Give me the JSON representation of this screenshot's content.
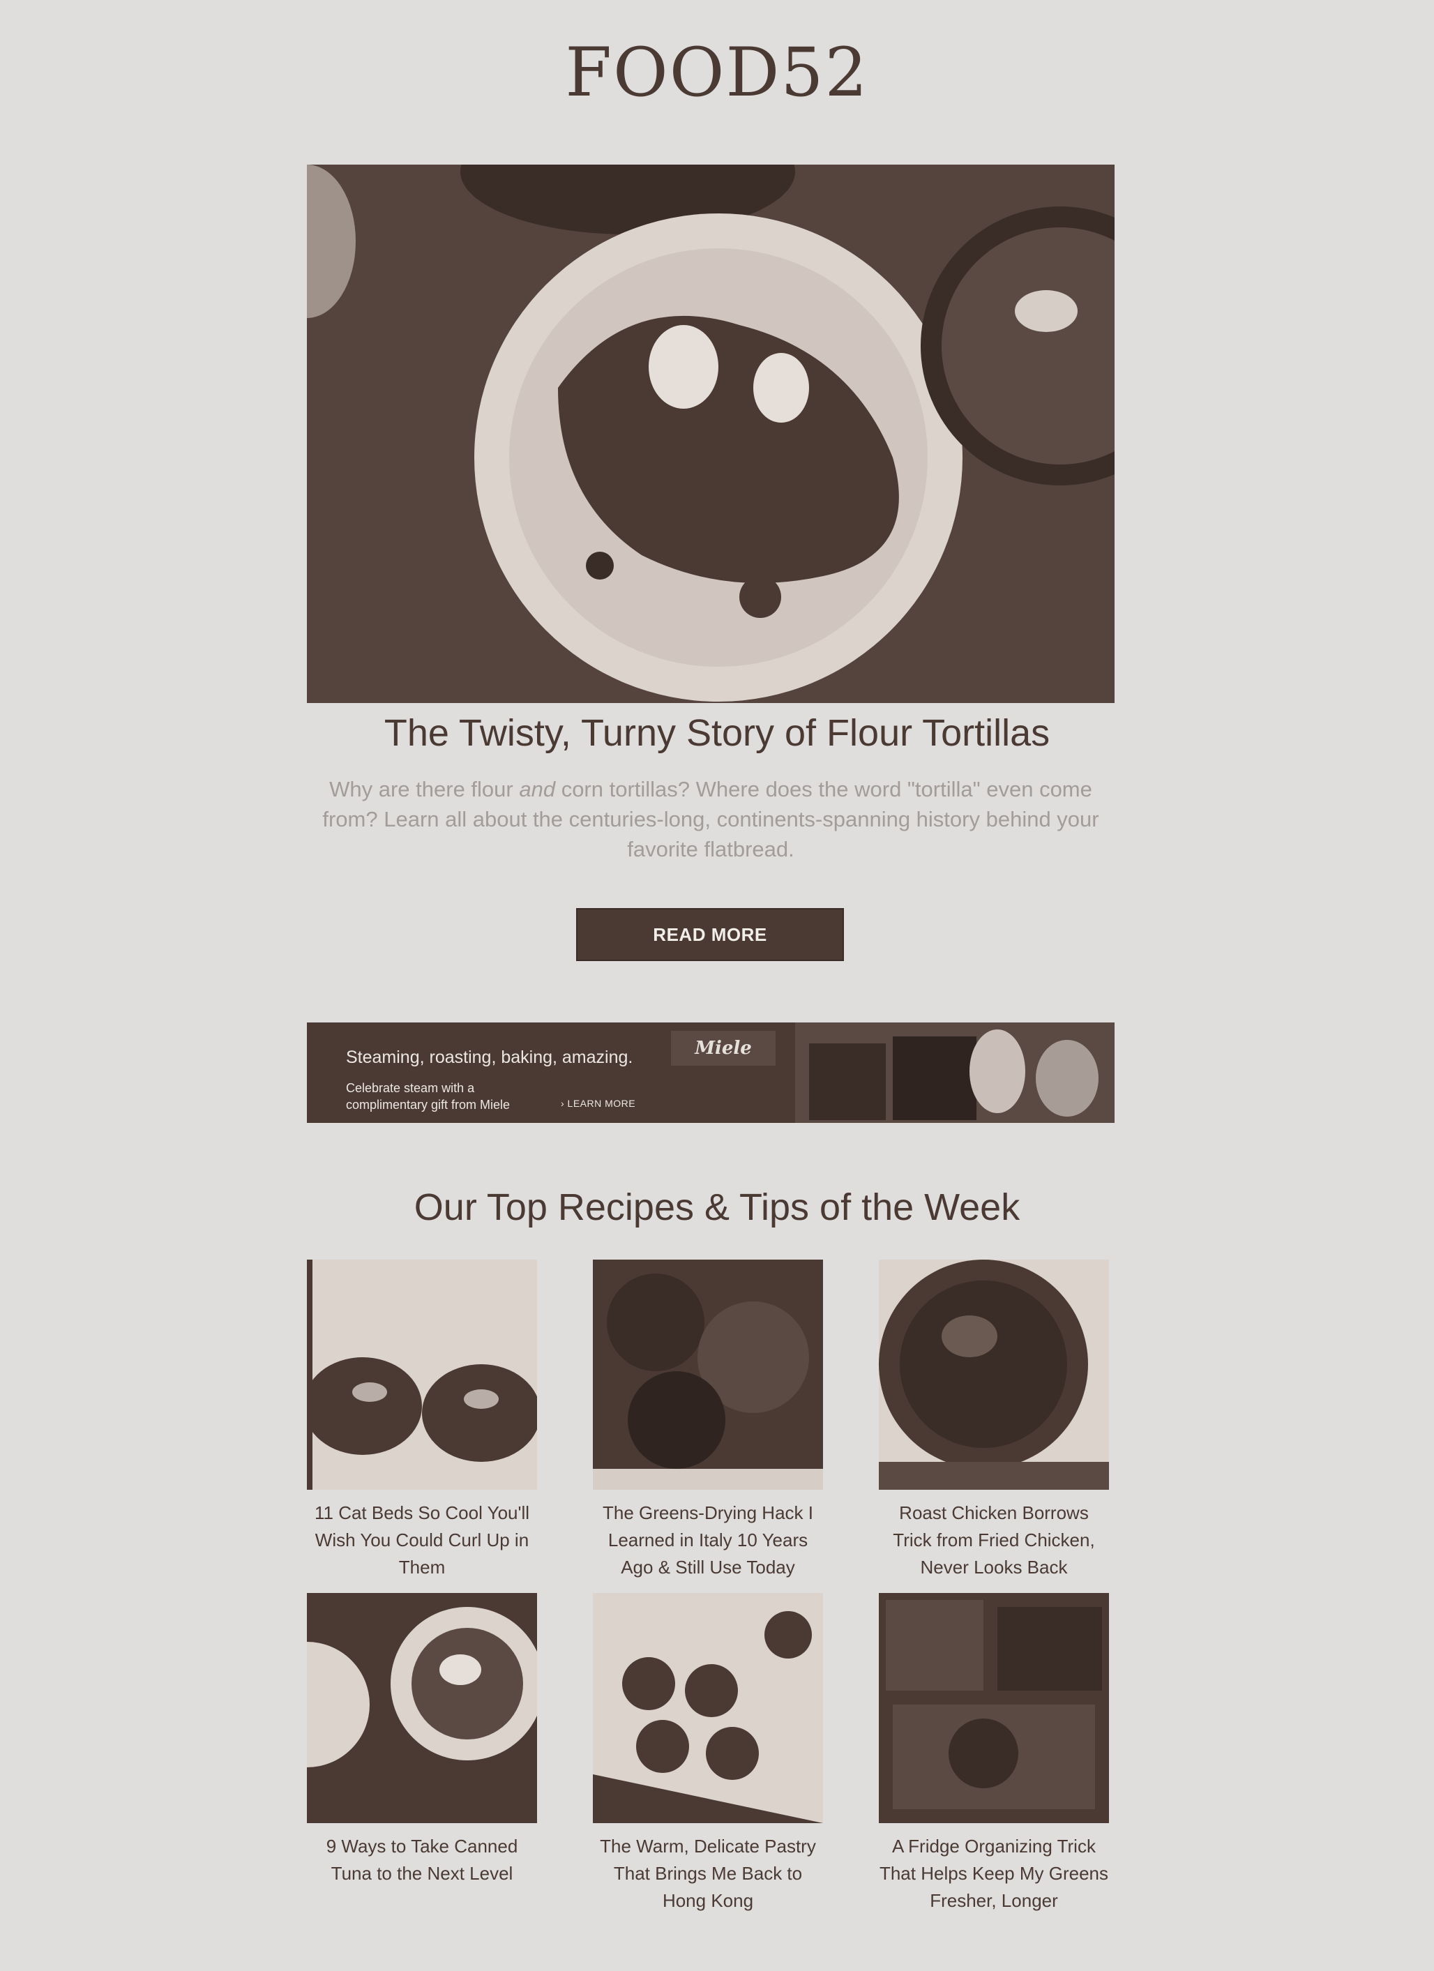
{
  "brand": {
    "logo": "FOOD52"
  },
  "hero": {
    "title": "The Twisty, Turny Story of Flour Tortillas",
    "desc_before": "Why are there flour ",
    "desc_em": "and",
    "desc_after": " corn tortillas? Where does the word \"tortilla\" even come from? Learn all about the centuries-long, continents-spanning history behind your favorite flatbread.",
    "button_label": "READ MORE"
  },
  "ad": {
    "headline": "Steaming, roasting, baking, amazing.",
    "subtext": "Celebrate steam with a complimentary gift from Miele",
    "cta": "› LEARN MORE",
    "brand": "Miele"
  },
  "top_section": {
    "title": "Our Top Recipes & Tips of the Week",
    "cards": [
      {
        "title": "11 Cat Beds So Cool You'll Wish You Could Curl Up in Them"
      },
      {
        "title": "The Greens-Drying Hack I Learned in Italy 10 Years Ago & Still Use Today"
      },
      {
        "title": "Roast Chicken Borrows Trick from Fried Chicken, Never Looks Back"
      },
      {
        "title": "9 Ways to Take Canned Tuna to the Next Level"
      },
      {
        "title": "The Warm, Delicate Pastry That Brings Me Back to Hong Kong"
      },
      {
        "title": "A Fridge Organizing Trick That Helps Keep My Greens Fresher, Longer"
      }
    ]
  },
  "colors": {
    "primary": "#4a3a33",
    "background": "#dfdedd",
    "muted_text": "#a39c98",
    "light": "#ece7e2"
  }
}
